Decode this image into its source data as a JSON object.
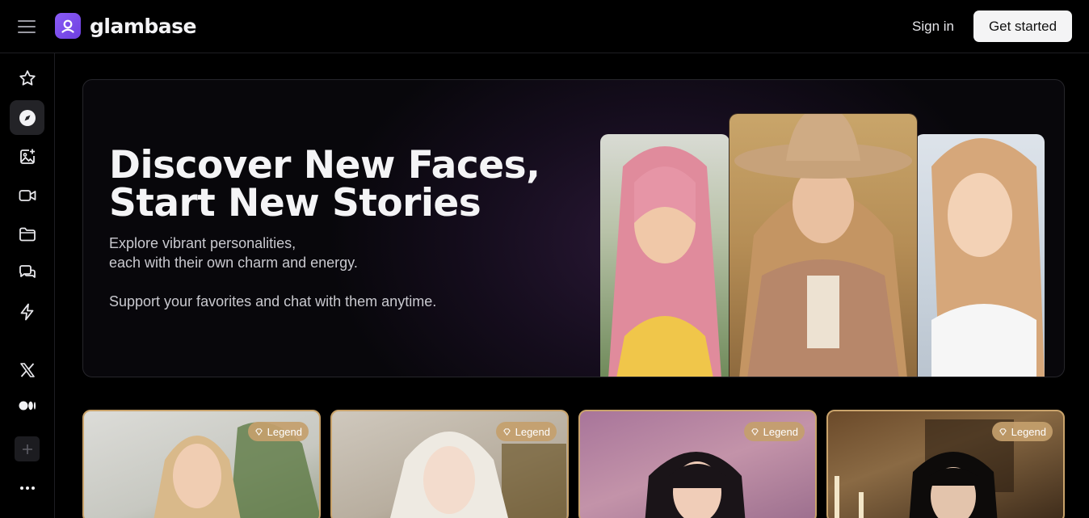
{
  "brand": {
    "name": "glambase"
  },
  "header": {
    "signin_label": "Sign in",
    "getstarted_label": "Get started"
  },
  "sidebar": {
    "items": [
      {
        "name": "favorites",
        "icon": "star-icon"
      },
      {
        "name": "explore",
        "icon": "compass-icon",
        "active": true
      },
      {
        "name": "generate-image",
        "icon": "image-plus-icon"
      },
      {
        "name": "video",
        "icon": "video-icon"
      },
      {
        "name": "collections",
        "icon": "folder-icon"
      },
      {
        "name": "chats",
        "icon": "chat-icon"
      },
      {
        "name": "boost",
        "icon": "lightning-icon"
      }
    ],
    "socials": [
      {
        "name": "x",
        "icon": "x-logo-icon"
      },
      {
        "name": "medium",
        "icon": "medium-logo-icon"
      }
    ],
    "extra": [
      {
        "name": "add",
        "icon": "plus-icon"
      },
      {
        "name": "more",
        "icon": "more-dots-icon"
      }
    ]
  },
  "hero": {
    "title_line1": "Discover New Faces,",
    "title_line2": "Start New Stories",
    "subtitle_line1": "Explore vibrant personalities,",
    "subtitle_line2": "each with their own charm and energy.",
    "subtitle_line3": "Support your favorites and chat with them anytime."
  },
  "cards": [
    {
      "badge": "Legend"
    },
    {
      "badge": "Legend"
    },
    {
      "badge": "Legend"
    },
    {
      "badge": "Legend"
    }
  ],
  "colors": {
    "accent": "#8b5cf6",
    "badge": "#c4a06c",
    "background": "#000000"
  }
}
